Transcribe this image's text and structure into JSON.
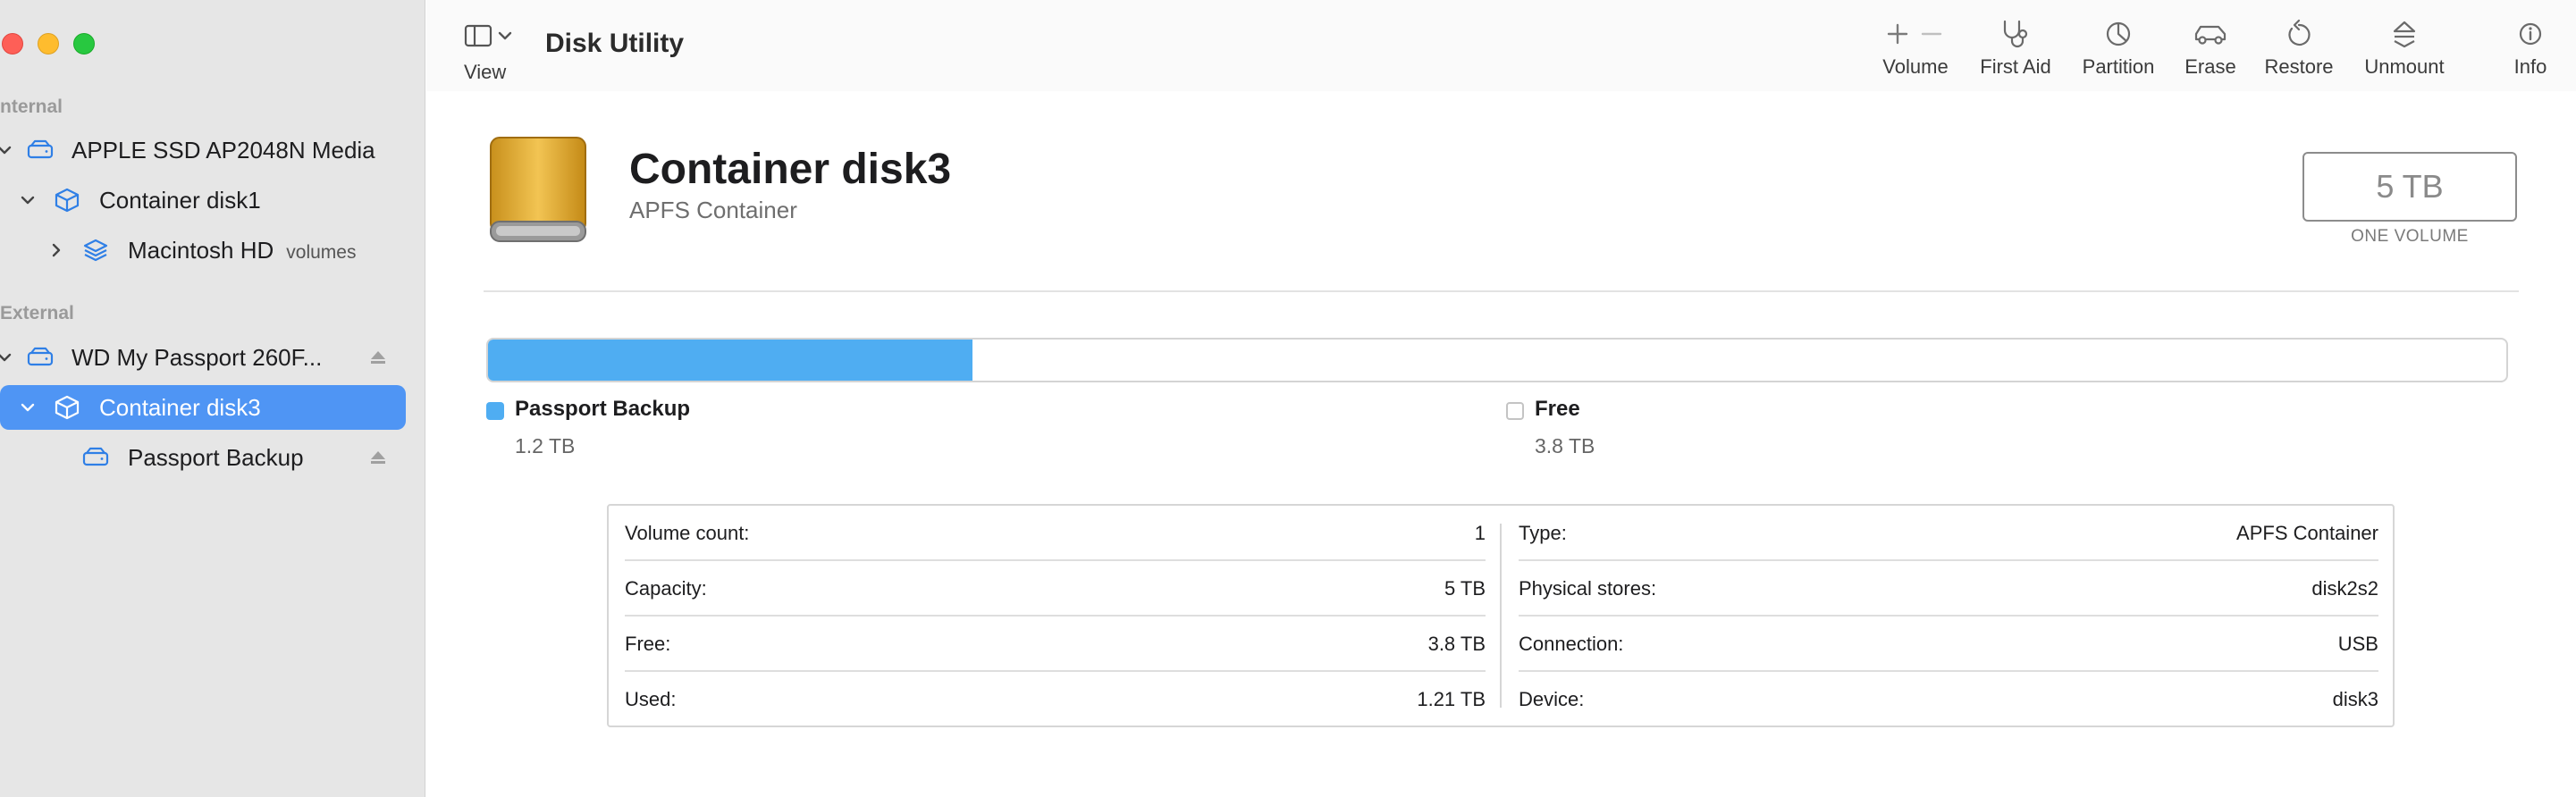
{
  "app": {
    "title": "Disk Utility"
  },
  "toolbar": {
    "view_label": "View",
    "items": [
      {
        "label": "Volume",
        "icon": "plus-minus-icon"
      },
      {
        "label": "First Aid",
        "icon": "stethoscope-icon"
      },
      {
        "label": "Partition",
        "icon": "pie-icon"
      },
      {
        "label": "Erase",
        "icon": "car-erase-icon"
      },
      {
        "label": "Restore",
        "icon": "restore-arrow-icon"
      },
      {
        "label": "Unmount",
        "icon": "eject-unmount-icon"
      },
      {
        "label": "Info",
        "icon": "info-icon"
      }
    ]
  },
  "sidebar": {
    "internal_label": "nternal",
    "external_label": "External",
    "items": [
      {
        "label": "APPLE SSD AP2048N Media",
        "icon": "drive-icon"
      },
      {
        "label": "Container disk1",
        "icon": "container-icon"
      },
      {
        "label": "Macintosh HD",
        "sub": "volumes",
        "icon": "volumes-stack-icon"
      },
      {
        "label": "WD My Passport 260F...",
        "icon": "drive-icon"
      },
      {
        "label": "Container disk3",
        "icon": "container-icon"
      },
      {
        "label": "Passport Backup",
        "icon": "drive-icon"
      }
    ]
  },
  "main": {
    "disk_name": "Container disk3",
    "disk_type": "APFS Container",
    "capacity_display": "5 TB",
    "capacity_sub": "ONE VOLUME",
    "usage": {
      "used_fraction": 0.24,
      "segments": [
        {
          "name": "Passport Backup",
          "value": "1.2 TB",
          "color": "#4fadf2"
        },
        {
          "name": "Free",
          "value": "3.8 TB",
          "color": "#ffffff"
        }
      ]
    },
    "info": {
      "left": [
        {
          "label": "Volume count:",
          "value": "1"
        },
        {
          "label": "Capacity:",
          "value": "5 TB"
        },
        {
          "label": "Free:",
          "value": "3.8 TB"
        },
        {
          "label": "Used:",
          "value": "1.21 TB"
        }
      ],
      "right": [
        {
          "label": "Type:",
          "value": "APFS Container"
        },
        {
          "label": "Physical stores:",
          "value": "disk2s2"
        },
        {
          "label": "Connection:",
          "value": "USB"
        },
        {
          "label": "Device:",
          "value": "disk3"
        }
      ]
    }
  }
}
